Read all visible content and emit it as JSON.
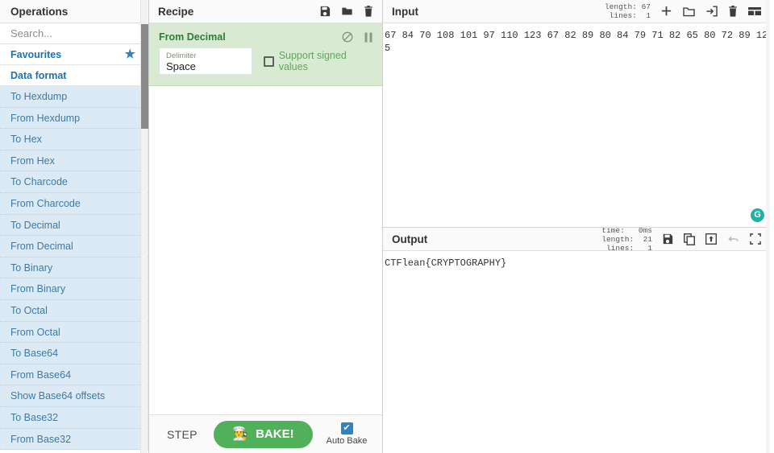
{
  "operations": {
    "title": "Operations",
    "search_placeholder": "Search...",
    "categories": [
      {
        "label": "Favourites",
        "icon": "star-icon"
      },
      {
        "label": "Data format"
      }
    ],
    "items": [
      "To Hexdump",
      "From Hexdump",
      "To Hex",
      "From Hex",
      "To Charcode",
      "From Charcode",
      "To Decimal",
      "From Decimal",
      "To Binary",
      "From Binary",
      "To Octal",
      "From Octal",
      "To Base64",
      "From Base64",
      "Show Base64 offsets",
      "To Base32",
      "From Base32"
    ]
  },
  "recipe": {
    "title": "Recipe",
    "icons": [
      "save-icon",
      "folder-icon",
      "trash-icon"
    ],
    "operation": {
      "name": "From Decimal",
      "controls": [
        "disable-icon",
        "breakpoint-icon"
      ],
      "args": {
        "delimiter_label": "Delimiter",
        "delimiter_value": "Space",
        "signed_label": "Support signed values",
        "signed_checked": false
      }
    },
    "controls": {
      "step_label": "STEP",
      "bake_label": "BAKE!",
      "bake_icon": "chef-icon",
      "auto_bake_label": "Auto Bake",
      "auto_bake_checked": true,
      "check_glyph": "✔"
    }
  },
  "input": {
    "title": "Input",
    "stats": {
      "length_label": "length:",
      "length_value": "67",
      "lines_label": "lines:",
      "lines_value": "1"
    },
    "icons": [
      "add-tab-icon",
      "folder-open-icon",
      "open-input-icon",
      "clear-input-icon",
      "reset-layout-icon"
    ],
    "value": "67 84 70 108 101 97 110 123 67 82 89 80 84 79 71 82 65 80 72 89 125",
    "magic_icon": "magic-wand-icon"
  },
  "output": {
    "title": "Output",
    "stats": {
      "time_label": "time:",
      "time_value": "0ms",
      "length_label": "length:",
      "length_value": "21",
      "lines_label": "lines:",
      "lines_value": "1"
    },
    "icons": [
      "save-output-icon",
      "copy-output-icon",
      "replace-input-icon",
      "undo-icon",
      "maximise-icon"
    ],
    "value": "CTFlean{CRYPTOGRAPHY}"
  },
  "colors": {
    "accent_blue": "#2d83c4",
    "op_item_bg": "#dbeaf5",
    "recipe_green": "#d9ead3",
    "bake_green": "#51b15a",
    "magic_teal": "#1ab3a6"
  }
}
